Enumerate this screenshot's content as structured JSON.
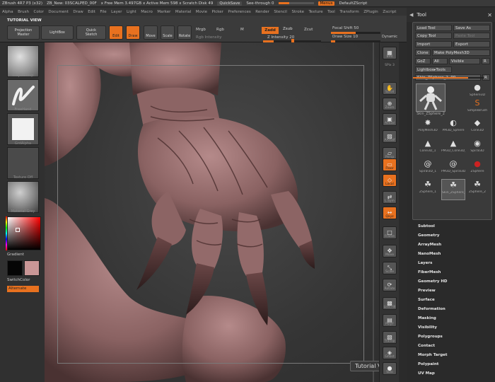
{
  "titlebar": {
    "app": "ZBrush 4R7 P3 (x32)",
    "doc": "ZB_New: 03SCALPED_00F",
    "stats": "x Free Mem 3.497GB x Active Mem 598 x Scratch Disk 49",
    "quicksave": "QuickSave",
    "see_through": "See-through 0",
    "menus": "Menus",
    "script": "DefaultZScript"
  },
  "menubar": [
    "Alpha",
    "Brush",
    "Color",
    "Document",
    "Draw",
    "Edit",
    "File",
    "Layer",
    "Light",
    "Macro",
    "Marker",
    "Material",
    "Movie",
    "Picker",
    "Preferences",
    "Render",
    "Stencil",
    "Stroke",
    "Texture",
    "Tool",
    "Transform",
    "ZPlugin",
    "Zscript"
  ],
  "shelf": {
    "tutorial": "TUTORIAL VIEW",
    "projection": "Projection",
    "projection2": "Master",
    "lightbox": "LightBox",
    "quick_sketch": "Quick",
    "quick_sketch2": "Sketch",
    "edit": "Edit",
    "draw": "Draw",
    "move": "Move",
    "scale": "Scale",
    "rotate": "Rotate",
    "mrgb": "Mrgb",
    "rgb": "Rgb",
    "m": "M",
    "rgb_intensity": "Rgb Intensity",
    "zadd": "Zadd",
    "zsub": "Zsub",
    "zcut": "Zcut",
    "z_intensity": "Z Intensity 20",
    "focal_shift": "Focal Shift 50",
    "draw_size": "Draw Size 10",
    "dynamic": "Dynamic"
  },
  "lefttray": {
    "brush": "ClayBuildup",
    "stroke": "FreeHand",
    "alpha": "GrdAlpha",
    "texture": "Texture Off",
    "material": "Material Grey",
    "gradient": "Gradient",
    "switch_color": "SwitchColor",
    "alternate": "Alternate"
  },
  "canvas": {
    "tutorial_view": "Tutorial View"
  },
  "rightshelf": [
    "BPR",
    "SPix 3",
    "Scroll",
    "Zoom",
    "Actual",
    "AAHalf",
    "Persp",
    "Floor",
    "Local",
    "L.Sym",
    "Qxyz",
    "Frame",
    "Move",
    "Scale",
    "Rotate",
    "Line Fill",
    "PolyF",
    "Transp",
    "Ghost",
    "Solo",
    "Xpose"
  ],
  "toolpanel": {
    "title": "Tool",
    "load": "Load Tool",
    "save_as": "Save As",
    "copy": "Copy Tool",
    "paste": "Paste Tool",
    "import": "Import",
    "export": "Export",
    "clone": "Clone",
    "make_poly": "Make PolyMesh3D",
    "goz": "GoZ",
    "all": "All",
    "visible": "Visible",
    "r": "R",
    "lightbox_tools": "Lightbox▸Tools",
    "current_tool": "Skin_ZSphere_2. 99",
    "r2": "R",
    "tools": [
      {
        "name": "Sphere3D",
        "glyph": "●",
        "c": ""
      },
      {
        "name": "SimpleBrush",
        "glyph": "S",
        "c": "o"
      },
      {
        "name": "PolyMesh3D",
        "glyph": "✸",
        "c": ""
      },
      {
        "name": "PM3D_Sphere",
        "glyph": "◐",
        "c": ""
      },
      {
        "name": "Cone3D",
        "glyph": "◆",
        "c": ""
      },
      {
        "name": "Cone3D_1",
        "glyph": "▲",
        "c": ""
      },
      {
        "name": "PM3D_Cone3D_1",
        "glyph": "▲",
        "c": ""
      },
      {
        "name": "Spiral3D",
        "glyph": "◉",
        "c": ""
      },
      {
        "name": "Spiral3D_1",
        "glyph": "@",
        "c": ""
      },
      {
        "name": "PM3D_Spiral3D_1",
        "glyph": "@",
        "c": ""
      },
      {
        "name": "ZSphere",
        "glyph": "●",
        "c": "r"
      },
      {
        "name": "ZSphere_1",
        "glyph": "☘",
        "c": ""
      },
      {
        "name": "Skin_ZSphere_2",
        "glyph": "☘",
        "c": ""
      },
      {
        "name": "ZSphere_2",
        "glyph": "☘",
        "c": ""
      }
    ],
    "main_tool": "Skin_ZSphere_2",
    "subpalettes": [
      "Subtool",
      "Geometry",
      "ArrayMesh",
      "NanoMesh",
      "Layers",
      "FiberMesh",
      "Geometry HD",
      "Preview",
      "Surface",
      "Deformation",
      "Masking",
      "Visibility",
      "Polygroups",
      "Contact",
      "Morph Target",
      "Polypaint",
      "UV Map"
    ]
  }
}
